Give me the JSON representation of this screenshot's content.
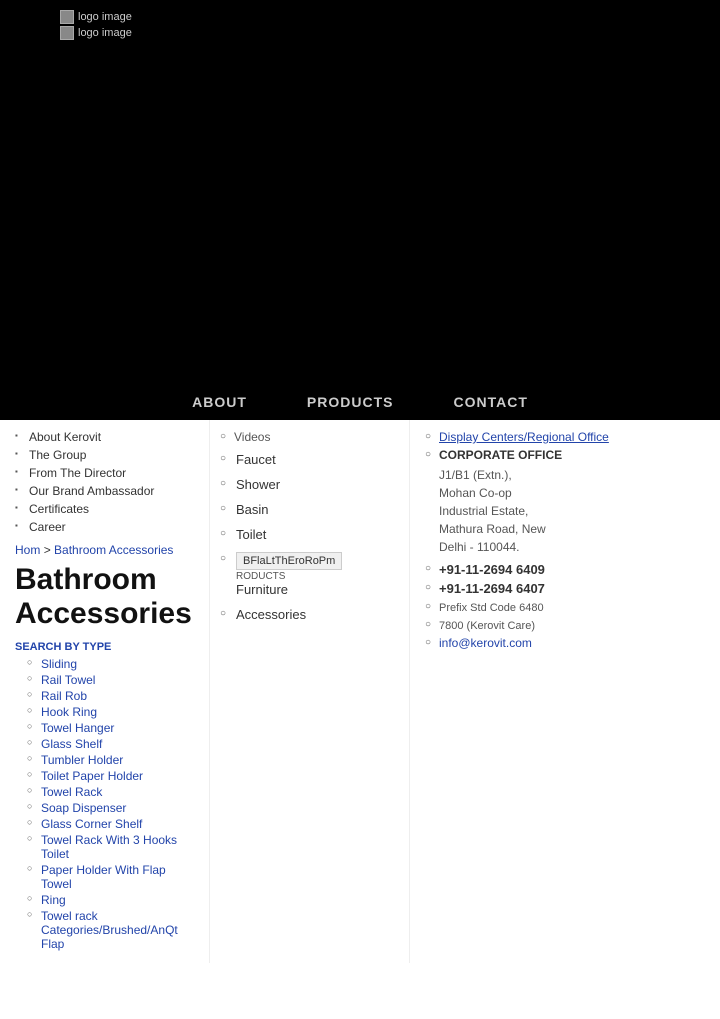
{
  "hero": {
    "logo_text_1": "logo image",
    "logo_text_2": "logo image"
  },
  "nav": {
    "items": [
      {
        "label": "ABOUT"
      },
      {
        "label": "PRODUCTS"
      },
      {
        "label": "CONTACT"
      }
    ]
  },
  "about_menu": {
    "items": [
      {
        "label": "About Kerovit"
      },
      {
        "label": "The Group"
      },
      {
        "label": "From The Director"
      },
      {
        "label": "Our Brand Ambassador"
      },
      {
        "label": "Certificates"
      },
      {
        "label": "Career"
      }
    ]
  },
  "products_menu": {
    "items": [
      {
        "label": "Faucet"
      },
      {
        "label": "Shower"
      },
      {
        "label": "Basin"
      },
      {
        "label": "Toilet"
      },
      {
        "label": "BFlaLtThEroRoPm",
        "sublabel": "RODUCTS",
        "category": "Furniture",
        "featured": true
      },
      {
        "label": "Accessories"
      }
    ],
    "videos_label": "Videos"
  },
  "contact": {
    "display_label": "Display Centers/Regional Office",
    "corporate_label": "CORPORATE OFFICE",
    "address_line1": "J1/B1 (Extn.),",
    "address_line2": "Mohan Co-op",
    "address_line3": "Industrial Estate,",
    "address_line4": "Mathura Road, New",
    "address_line5": "Delhi - 110044.",
    "phone1": "+91-11-2694 6409",
    "phone2": "+91-11-2694 6407",
    "prefix_label": "Prefix Std Code 6480",
    "kerovit_care": "7800 (Kerovit Care)",
    "email": "info@kerovit.com"
  },
  "breadcrumb": {
    "home": "Hom",
    "separator": ">",
    "current": "Bathroom Accessories"
  },
  "page_title": "Bathroom Accessories",
  "sidebar": {
    "search_by_type_label": "SEARCH BY TYPE",
    "items": [
      {
        "label": "Sliding"
      },
      {
        "label": "Rail Towel"
      },
      {
        "label": "Rail Rob"
      },
      {
        "label": "Hook Ring",
        "strikethrough": true
      },
      {
        "label": "Towel Hanger"
      },
      {
        "label": "Glass Shelf"
      },
      {
        "label": "Tumbler Holder"
      },
      {
        "label": "Toilet Paper Holder"
      },
      {
        "label": "Towel Rack"
      },
      {
        "label": "Soap Dispenser",
        "strikethrough": true
      },
      {
        "label": "Glass Corner Shelf"
      },
      {
        "label": "Towel Rack With 3 Hooks Toilet"
      },
      {
        "label": "Paper Holder With Flap Towel"
      },
      {
        "label": "Ring"
      }
    ]
  },
  "bottom_link": {
    "text": "Towel rack Categories/Brushed/AnQt Flap"
  }
}
